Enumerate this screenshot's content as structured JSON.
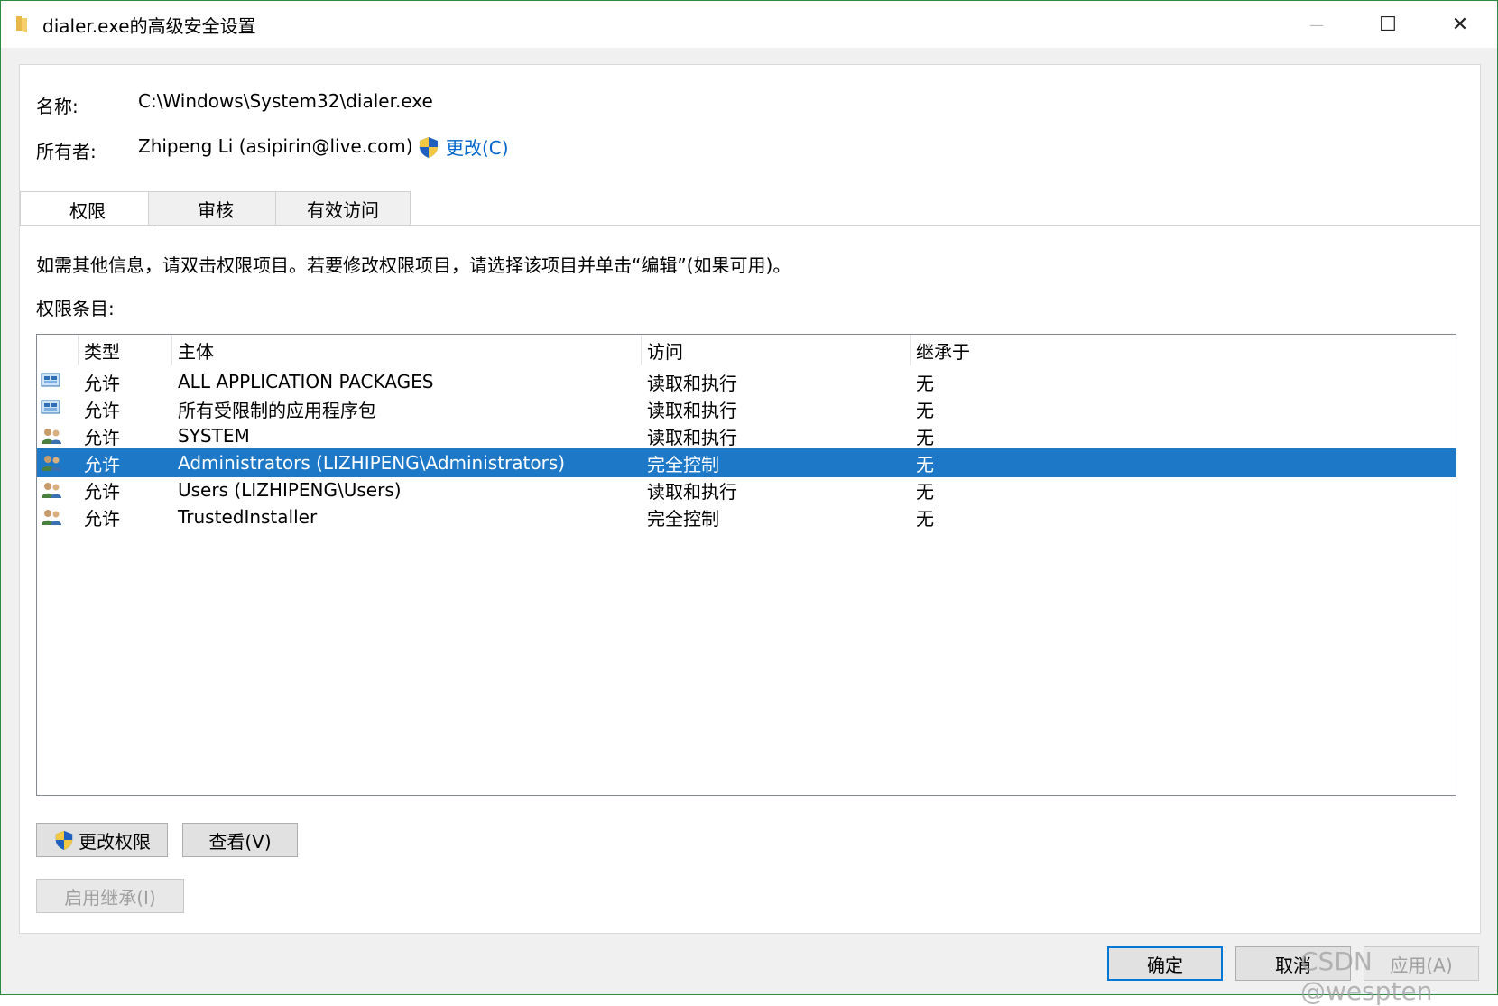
{
  "window": {
    "title": "dialer.exe的高级安全设置",
    "controls": {
      "minimize": "—",
      "maximize": "☐",
      "close": "✕"
    }
  },
  "info": {
    "name_label": "名称:",
    "name_value": "C:\\Windows\\System32\\dialer.exe",
    "owner_label": "所有者:",
    "owner_value": "Zhipeng Li (asipirin@live.com)",
    "change_link": "更改(C)"
  },
  "tabs": [
    {
      "label": "权限",
      "active": true
    },
    {
      "label": "审核",
      "active": false
    },
    {
      "label": "有效访问",
      "active": false
    }
  ],
  "description": "如需其他信息，请双击权限项目。若要修改权限项目，请选择该项目并单击“编辑”(如果可用)。",
  "entries_label": "权限条目:",
  "table": {
    "columns": [
      "类型",
      "主体",
      "访问",
      "继承于"
    ],
    "rows": [
      {
        "icon": "app-package-icon",
        "type": "允许",
        "principal": "ALL APPLICATION PACKAGES",
        "access": "读取和执行",
        "inherited": "无",
        "selected": false
      },
      {
        "icon": "app-package-icon",
        "type": "允许",
        "principal": "所有受限制的应用程序包",
        "access": "读取和执行",
        "inherited": "无",
        "selected": false
      },
      {
        "icon": "users-group-icon",
        "type": "允许",
        "principal": "SYSTEM",
        "access": "读取和执行",
        "inherited": "无",
        "selected": false
      },
      {
        "icon": "users-group-icon",
        "type": "允许",
        "principal": "Administrators (LIZHIPENG\\Administrators)",
        "access": "完全控制",
        "inherited": "无",
        "selected": true
      },
      {
        "icon": "users-group-icon",
        "type": "允许",
        "principal": "Users (LIZHIPENG\\Users)",
        "access": "读取和执行",
        "inherited": "无",
        "selected": false
      },
      {
        "icon": "users-group-icon",
        "type": "允许",
        "principal": "TrustedInstaller",
        "access": "完全控制",
        "inherited": "无",
        "selected": false
      }
    ]
  },
  "buttons": {
    "change_permissions": "更改权限",
    "view": "查看(V)",
    "enable_inheritance": "启用继承(I)",
    "ok": "确定",
    "cancel": "取消",
    "apply": "应用(A)"
  },
  "watermark": "CSDN @wespten",
  "colors": {
    "selection": "#1e78c8",
    "link": "#0066cc",
    "window_border": "#2b8a3e"
  }
}
